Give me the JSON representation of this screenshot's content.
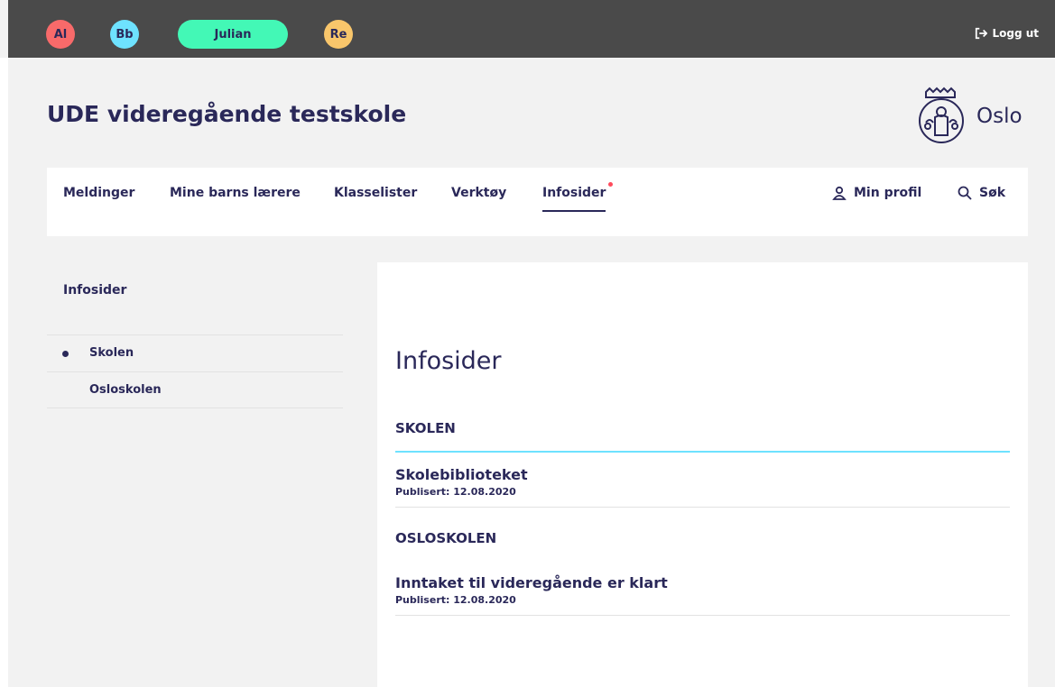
{
  "top_bar": {
    "profiles": [
      {
        "label": "Al",
        "color": "#f86a6a"
      },
      {
        "label": "Bb",
        "color": "#6ee2ff"
      },
      {
        "label": "Julian",
        "color": "#43f8b6"
      },
      {
        "label": "Re",
        "color": "#f9c66b"
      }
    ],
    "logout_label": "Logg ut"
  },
  "header": {
    "school_name": "UDE videregående testskole",
    "logo_text": "Oslo"
  },
  "nav": {
    "items": [
      {
        "label": "Meldinger"
      },
      {
        "label": "Mine barns lærere"
      },
      {
        "label": "Klasselister"
      },
      {
        "label": "Verktøy"
      },
      {
        "label": "Infosider",
        "active": true,
        "has_notification": true
      }
    ],
    "profile_label": "Min profil",
    "search_label": "Søk"
  },
  "sidebar": {
    "title": "Infosider",
    "items": [
      {
        "label": "Skolen",
        "selected": true
      },
      {
        "label": "Osloskolen"
      }
    ]
  },
  "main": {
    "title": "Infosider",
    "sections": [
      {
        "heading": "SKOLEN",
        "articles": [
          {
            "title": "Skolebiblioteket",
            "published": "Publisert: 12.08.2020"
          }
        ]
      },
      {
        "heading": "OSLOSKOLEN",
        "articles": [
          {
            "title": "Inntaket til videregående er klart",
            "published": "Publisert: 12.08.2020"
          }
        ]
      }
    ]
  },
  "colors": {
    "primary_text": "#2a2859",
    "top_bar": "#4a4a4a",
    "accent_rule": "#6ee2ff",
    "notification": "#ff4b5c"
  }
}
